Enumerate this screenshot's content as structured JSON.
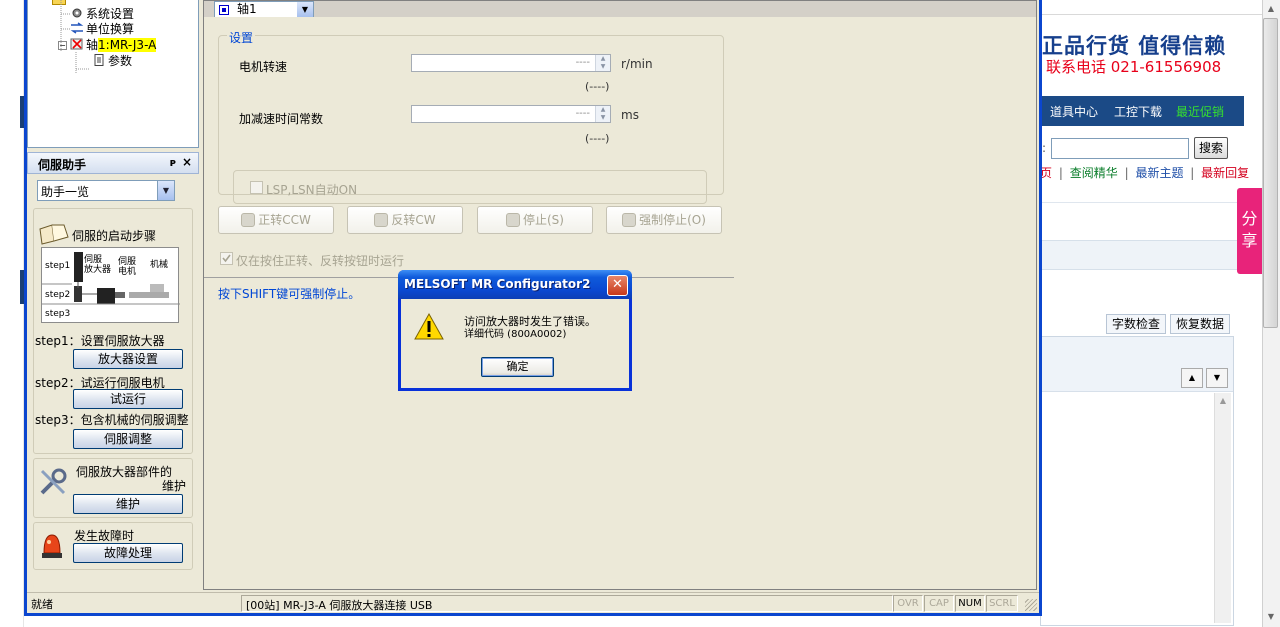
{
  "web": {
    "slogan": "正品行货 值得信赖",
    "phone": "联系电话 021-61556908",
    "nav": [
      "道具中心",
      "工控下载",
      "最近促销"
    ],
    "search_colon": ":",
    "search_button": "搜索",
    "links": [
      {
        "text": "页",
        "cls": "lnk-red"
      },
      {
        "text": "|",
        "cls": "lnk-sep"
      },
      {
        "text": "查阅精华",
        "cls": "lnk-green"
      },
      {
        "text": "|",
        "cls": "lnk-sep"
      },
      {
        "text": "最新主题",
        "cls": "lnk-blue"
      },
      {
        "text": "|",
        "cls": "lnk-sep"
      },
      {
        "text": "最新回复",
        "cls": "lnk-red"
      }
    ],
    "share": "分享",
    "btn_wordcount": "字数检查",
    "btn_restore": "恢复数据"
  },
  "tree": {
    "system_settings": "系统设置",
    "unit_conversion": "单位换算",
    "axis_node_prefix": "轴",
    "axis_node_sel": "1:MR-J3-A",
    "params": "参数"
  },
  "assistant": {
    "title": "伺服助手",
    "pin": "ᴘ",
    "close": "×",
    "select_value": "助手一览",
    "startup_title": "伺服的启动步骤",
    "diagram": {
      "step1": "step1",
      "step2": "step2",
      "step3": "step3",
      "amp": "伺服\n放大器",
      "motor": "伺服\n电机",
      "machine": "机械"
    },
    "step1_label": "step1：设置伺服放大器",
    "step1_btn": "放大器设置",
    "step2_label": "step2：试运行伺服电机",
    "step2_btn": "试运行",
    "step3_label": "step3：包含机械的伺服调整",
    "step3_btn": "伺服调整",
    "maint_line1": "伺服放大器部件的",
    "maint_line2": "维护",
    "maint_btn": "维护",
    "fault_label": "发生故障时",
    "fault_btn": "故障处理"
  },
  "main": {
    "axis_combo": "轴1",
    "settings_legend": "设置",
    "motor_speed_label": "电机转速",
    "motor_speed_value": "----",
    "motor_speed_unit": "r/min",
    "motor_speed_range": "(----)",
    "accel_label": "加减速时间常数",
    "accel_value": "----",
    "accel_unit": "ms",
    "accel_range": "(----)",
    "lsp_label": "LSP,LSN自动ON",
    "btn_ccw": "正转CCW",
    "btn_cw": "反转CW",
    "btn_stop": "停止(S)",
    "btn_force_stop": "强制停止(O)",
    "hold_label": "仅在按住正转、反转按钮时运行",
    "shift_note": "按下SHIFT键可强制停止。"
  },
  "status": {
    "ready": "就绪",
    "connection": "[00站] MR-J3-A 伺服放大器连接 USB",
    "ovr": "OVR",
    "cap": "CAP",
    "num": "NUM",
    "scrl": "SCRL"
  },
  "dialog": {
    "title": "MELSOFT MR Configurator2",
    "message": "访问放大器时发生了错误。",
    "detail": "详细代码 (800A0002)",
    "ok": "确定",
    "close": "✕"
  },
  "colors": {
    "window_frame": "#0b46cf",
    "dialog_title": "#0a48d1",
    "nav_blue": "#1b4a86",
    "share_pink": "#e8237a",
    "slogan_blue": "#163f8c",
    "phone_red": "#e8001a",
    "highlight_yellow": "#ffff00"
  }
}
